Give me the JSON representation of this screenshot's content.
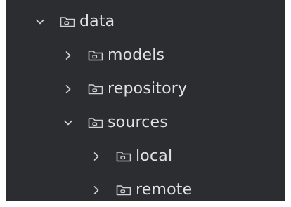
{
  "project_tree": {
    "items": [
      {
        "label": "data",
        "expanded": true,
        "depth": 0,
        "icon": "folder-icon"
      },
      {
        "label": "models",
        "expanded": false,
        "depth": 1,
        "icon": "folder-icon"
      },
      {
        "label": "repository",
        "expanded": false,
        "depth": 1,
        "icon": "folder-icon"
      },
      {
        "label": "sources",
        "expanded": true,
        "depth": 1,
        "icon": "folder-icon"
      },
      {
        "label": "local",
        "expanded": false,
        "depth": 2,
        "icon": "folder-icon"
      },
      {
        "label": "remote",
        "expanded": false,
        "depth": 2,
        "icon": "folder-icon"
      }
    ]
  },
  "colors": {
    "background": "#2b2d30",
    "text": "#dfe1e5",
    "icon": "#ced0d6"
  }
}
